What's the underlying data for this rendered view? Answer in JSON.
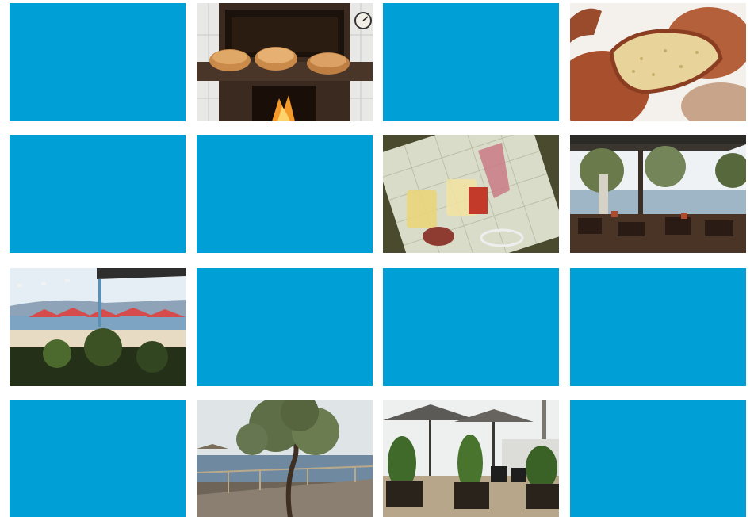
{
  "colors": {
    "placeholder": "#009fd6",
    "background": "#ffffff"
  },
  "gallery": {
    "tiles": [
      {
        "row": 1,
        "col": 1,
        "kind": "placeholder"
      },
      {
        "row": 1,
        "col": 2,
        "kind": "photo",
        "subject": "wood-fired-oven-with-bread-loaves"
      },
      {
        "row": 1,
        "col": 3,
        "kind": "placeholder"
      },
      {
        "row": 1,
        "col": 4,
        "kind": "photo",
        "subject": "sliced-bread-loaf"
      },
      {
        "row": 2,
        "col": 1,
        "kind": "placeholder"
      },
      {
        "row": 2,
        "col": 2,
        "kind": "placeholder"
      },
      {
        "row": 2,
        "col": 3,
        "kind": "photo",
        "subject": "menu-with-drinks-on-table"
      },
      {
        "row": 2,
        "col": 4,
        "kind": "photo",
        "subject": "seaside-terrace-under-trees"
      },
      {
        "row": 3,
        "col": 1,
        "kind": "photo",
        "subject": "beach-with-red-umbrellas"
      },
      {
        "row": 3,
        "col": 2,
        "kind": "placeholder"
      },
      {
        "row": 3,
        "col": 3,
        "kind": "placeholder"
      },
      {
        "row": 3,
        "col": 4,
        "kind": "placeholder"
      },
      {
        "row": 4,
        "col": 1,
        "kind": "placeholder"
      },
      {
        "row": 4,
        "col": 2,
        "kind": "photo",
        "subject": "tamarisk-tree-by-sea"
      },
      {
        "row": 4,
        "col": 3,
        "kind": "photo",
        "subject": "terrace-with-parasols-and-planters"
      },
      {
        "row": 4,
        "col": 4,
        "kind": "placeholder"
      }
    ]
  }
}
